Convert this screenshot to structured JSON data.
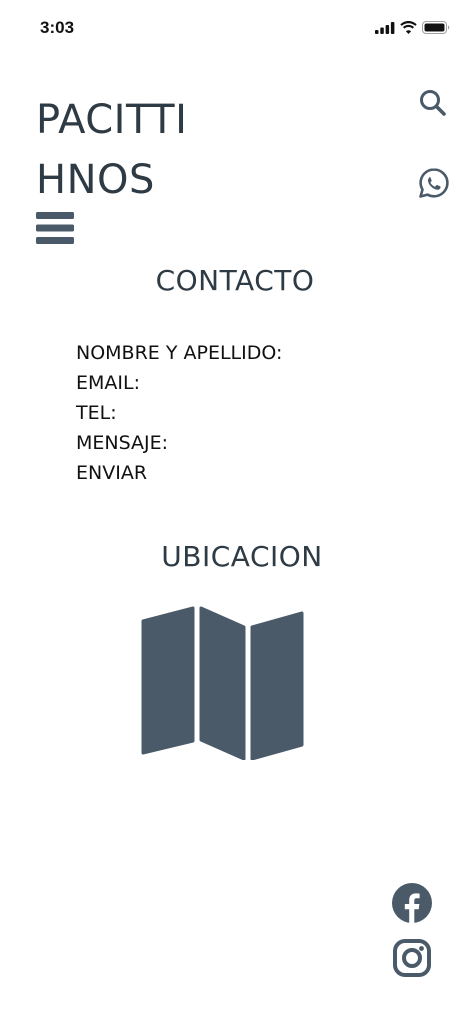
{
  "status_bar": {
    "time": "3:03",
    "icons": [
      "signal-icon",
      "wifi-icon",
      "battery-icon"
    ]
  },
  "header": {
    "brand_line_1": "PACITTI",
    "brand_line_2": "HNOS",
    "icons": [
      "search-icon",
      "whatsapp-icon",
      "menu-icon"
    ]
  },
  "contact": {
    "title": "CONTACTO",
    "fields": [
      "NOMBRE Y APELLIDO:",
      "EMAIL:",
      "TEL:",
      "MENSAJE:"
    ],
    "submit_label": "ENVIAR"
  },
  "location": {
    "title": "UBICACION",
    "icon": "map-icon"
  },
  "social": {
    "icons": [
      "facebook-icon",
      "instagram-icon"
    ]
  },
  "colors": {
    "primary": "#4a5a68",
    "text": "#2e3a44",
    "background": "#ffffff"
  }
}
